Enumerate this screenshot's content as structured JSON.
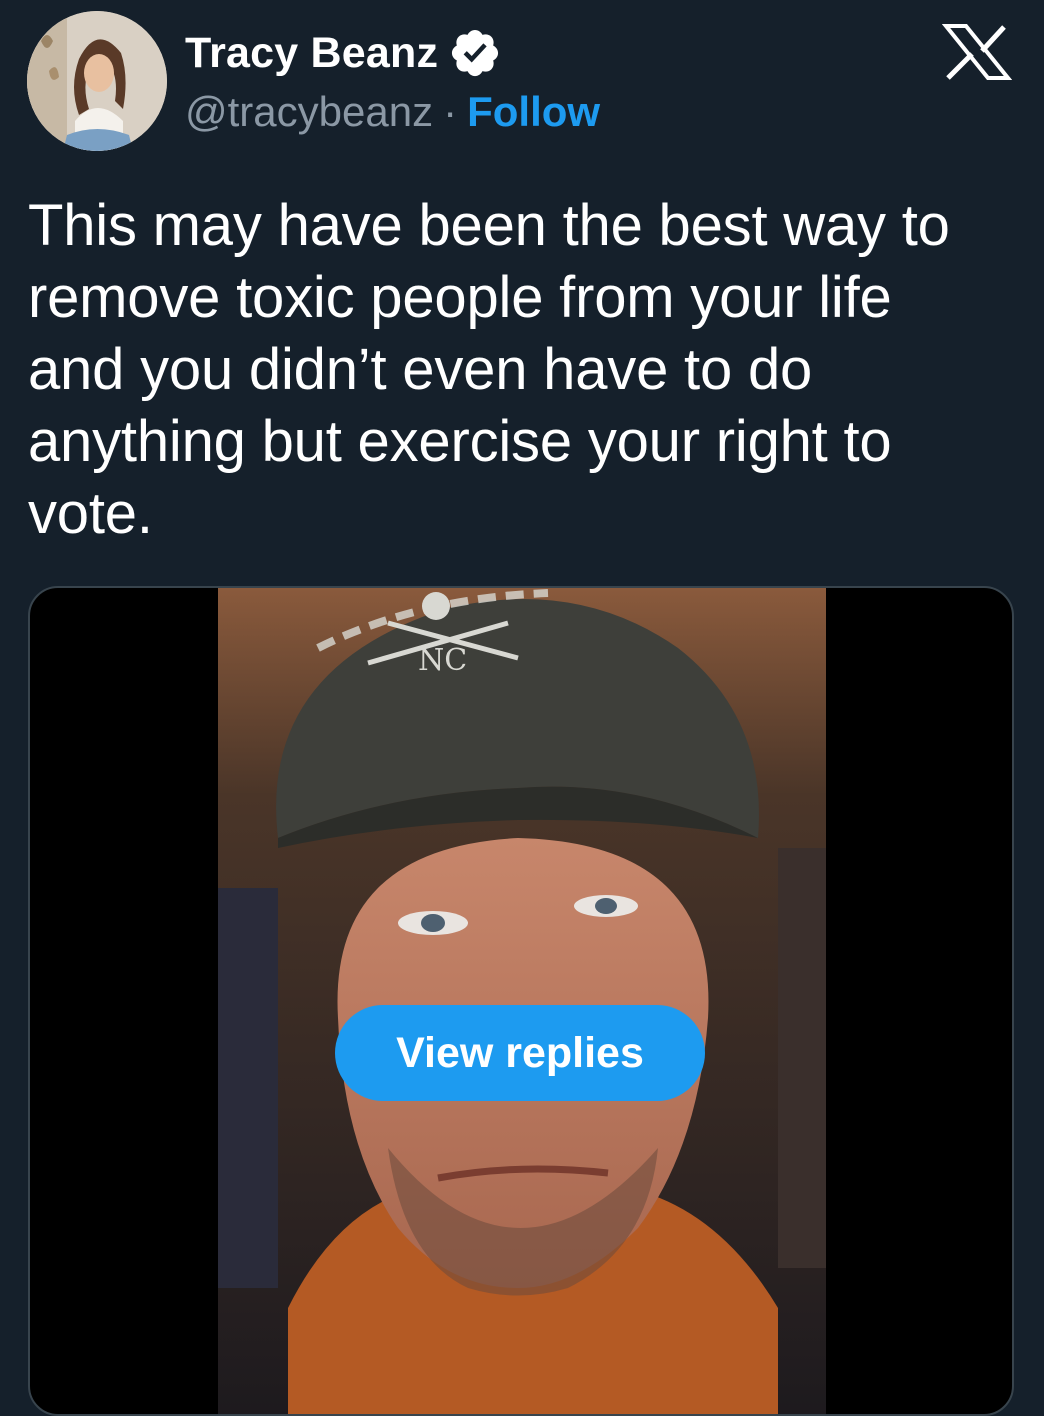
{
  "author": {
    "name": "Tracy Beanz",
    "handle": "@tracybeanz",
    "separator": "·",
    "follow_label": "Follow",
    "verified": true
  },
  "tweet": {
    "text": "This may have been the best way to remove toxic people from your life and you didn’t even have to do anything but exercise your right to vote."
  },
  "media": {
    "type": "video",
    "cap_text": "NC",
    "overlay_button_label": "View replies"
  },
  "icons": {
    "platform_logo": "x-logo-icon",
    "verified_badge": "verified-check-icon"
  },
  "colors": {
    "background": "#15202b",
    "accent": "#1d9bf0",
    "secondary_text": "#8b98a5",
    "border": "#38444d"
  }
}
